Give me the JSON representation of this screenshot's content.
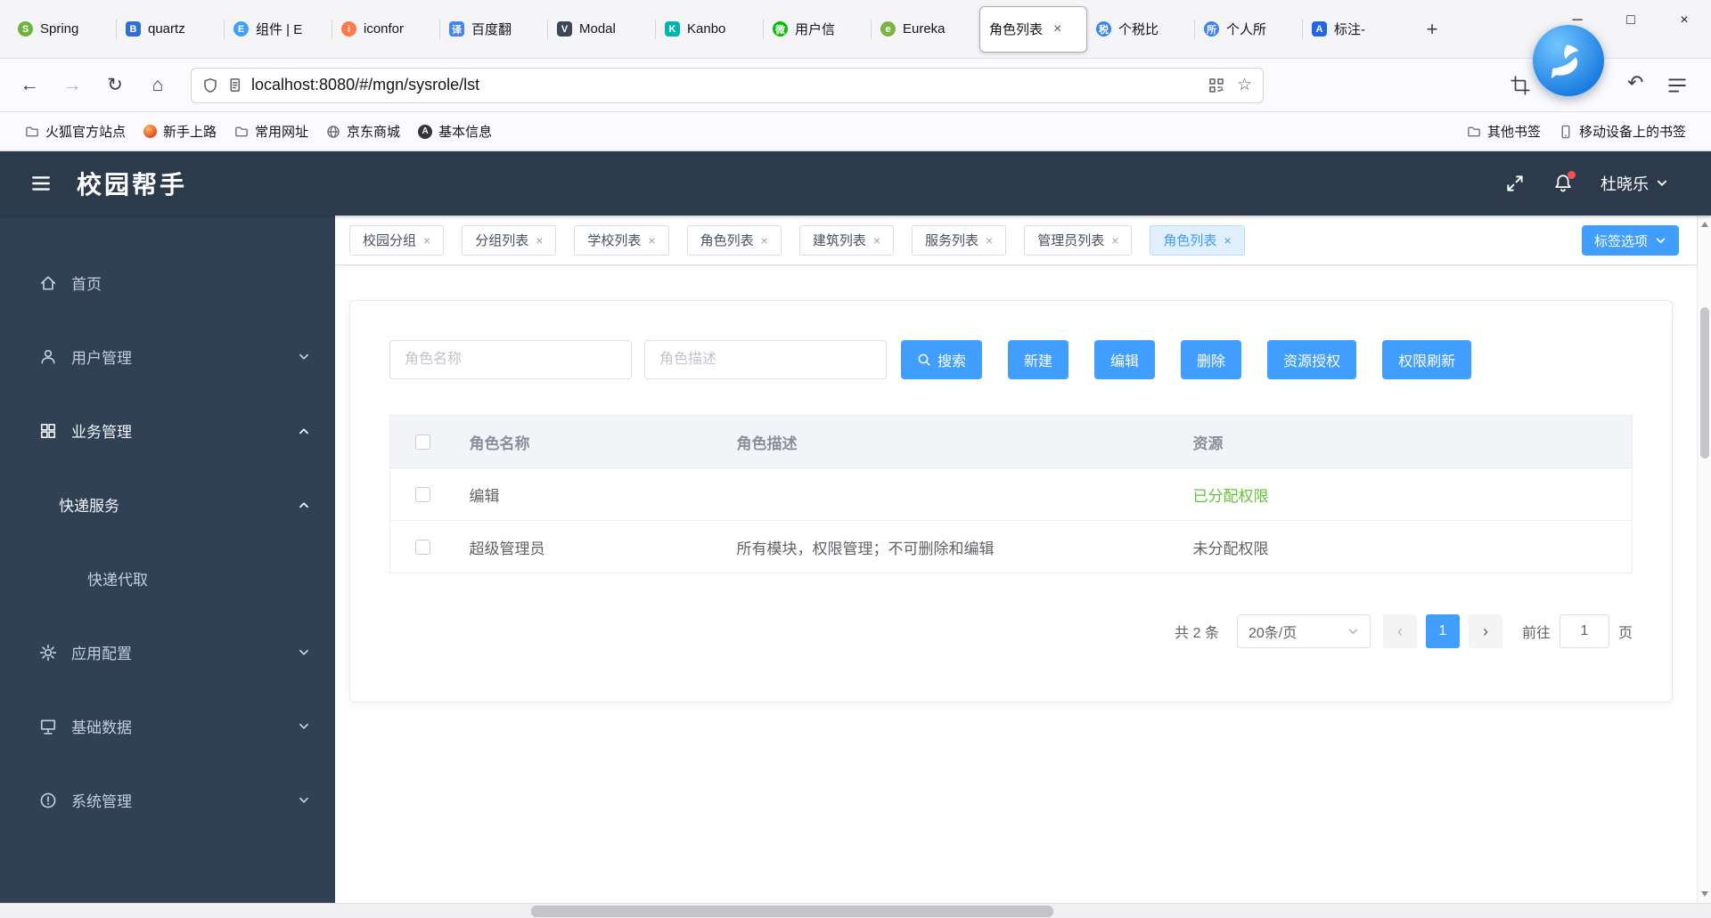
{
  "colors": {
    "primary": "#409eff",
    "success": "#67c23a",
    "header_bg": "#2d3a4b",
    "sidebar_bg": "#304156"
  },
  "browser": {
    "tabs": [
      {
        "label": "Spring",
        "icon": "spring-icon",
        "icon_glyph": "S",
        "icon_color": "#6db33f"
      },
      {
        "label": "quartz",
        "icon": "quartz-icon",
        "icon_glyph": "B",
        "icon_color": "#2f6fd6"
      },
      {
        "label": "组件 | E",
        "icon": "element-icon",
        "icon_glyph": "E",
        "icon_color": "#409eff"
      },
      {
        "label": "iconfor",
        "icon": "iconfont-icon",
        "icon_glyph": "i",
        "icon_color": "#ff7a45"
      },
      {
        "label": "百度翻",
        "icon": "baidu-translate-icon",
        "icon_glyph": "译",
        "icon_color": "#4285f4"
      },
      {
        "label": "Modal",
        "icon": "modal-icon",
        "icon_glyph": "V",
        "icon_color": "#3c4858"
      },
      {
        "label": "Kanbo",
        "icon": "kanboard-icon",
        "icon_glyph": "K",
        "icon_color": "#00b5ad"
      },
      {
        "label": "用户信",
        "icon": "wechat-icon",
        "icon_glyph": "微",
        "icon_color": "#09bb07"
      },
      {
        "label": "Eureka",
        "icon": "eureka-icon",
        "icon_glyph": "e",
        "icon_color": "#7cb342"
      },
      {
        "label": "角色列表",
        "active": true,
        "close_glyph": "×"
      },
      {
        "label": "个税比",
        "icon": "tax-icon",
        "icon_glyph": "税",
        "icon_color": "#3b82f6"
      },
      {
        "label": "个人所",
        "icon": "personal-tax-icon",
        "icon_glyph": "所",
        "icon_color": "#3b82f6"
      },
      {
        "label": "标注-",
        "icon": "annotate-icon",
        "icon_glyph": "A",
        "icon_color": "#2563eb"
      }
    ],
    "new_tab_label": "+",
    "window_controls": {
      "minimize": "─",
      "maximize": "□",
      "close": "×"
    },
    "nav": {
      "back": "←",
      "forward": "→",
      "reload": "↻",
      "home": "⌂"
    },
    "url": "localhost:8080/#/mgn/sysrole/lst",
    "star_glyph": "☆",
    "undo_glyph": "↶",
    "circle_a_glyph": "A",
    "bookmarks_left": [
      "火狐官方站点",
      "新手上路",
      "常用网址",
      "京东商城",
      "基本信息"
    ],
    "bookmarks_right": [
      "其他书签",
      "移动设备上的书签"
    ]
  },
  "app": {
    "header": {
      "title": "校园帮手",
      "user": "杜晓乐"
    },
    "sidebar": [
      {
        "label": "首页"
      },
      {
        "label": "用户管理"
      },
      {
        "label": "业务管理"
      },
      {
        "label": "快递服务"
      },
      {
        "label": "快递代取"
      },
      {
        "label": "应用配置"
      },
      {
        "label": "基础数据"
      },
      {
        "label": "系统管理"
      }
    ],
    "tags": [
      {
        "label": "校园分组"
      },
      {
        "label": "分组列表"
      },
      {
        "label": "学校列表"
      },
      {
        "label": "角色列表"
      },
      {
        "label": "建筑列表"
      },
      {
        "label": "服务列表"
      },
      {
        "label": "管理员列表"
      },
      {
        "label": "角色列表",
        "active": true
      }
    ],
    "tag_close_glyph": "×",
    "tags_options_label": "标签选项",
    "filters": {
      "name_placeholder": "角色名称",
      "desc_placeholder": "角色描述"
    },
    "actions": {
      "search": "搜索",
      "create": "新建",
      "edit": "编辑",
      "delete": "删除",
      "authorize": "资源授权",
      "refresh": "权限刷新"
    },
    "table": {
      "columns": [
        "角色名称",
        "角色描述",
        "资源"
      ],
      "rows": [
        {
          "name": "编辑",
          "desc": "",
          "resource": "已分配权限",
          "resource_color": "#67c23a"
        },
        {
          "name": "超级管理员",
          "desc": "所有模块，权限管理；不可删除和编辑",
          "resource": "未分配权限",
          "resource_color": "#606266"
        }
      ]
    },
    "pagination": {
      "total": "共 2 条",
      "page_size": "20条/页",
      "prev": "‹",
      "page": "1",
      "next": "›",
      "goto_label": "前往",
      "goto_value": "1",
      "unit": "页"
    }
  }
}
